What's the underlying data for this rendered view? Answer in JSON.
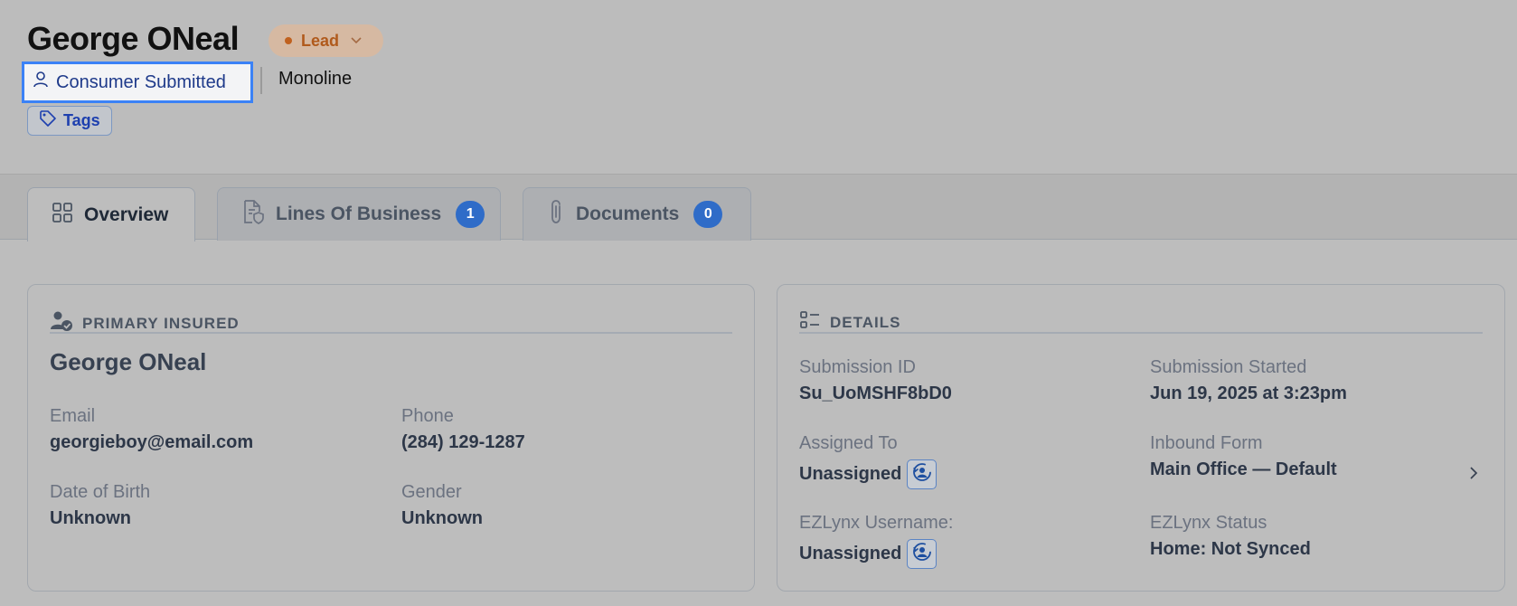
{
  "header": {
    "title": "George ONeal",
    "status": {
      "label": "Lead",
      "color": "#c0611f"
    },
    "source": "Consumer Submitted",
    "lob_type": "Monoline",
    "tags_label": "Tags"
  },
  "tabs": [
    {
      "label": "Overview",
      "icon": "grid-icon",
      "active": true
    },
    {
      "label": "Lines Of Business",
      "icon": "document-shield-icon",
      "badge": "1"
    },
    {
      "label": "Documents",
      "icon": "paperclip-icon",
      "badge": "0"
    }
  ],
  "primary_insured": {
    "heading": "PRIMARY INSURED",
    "name": "George ONeal",
    "fields": {
      "email": {
        "label": "Email",
        "value": "georgieboy@email.com"
      },
      "phone": {
        "label": "Phone",
        "value": "(284) 129-1287"
      },
      "dob": {
        "label": "Date of Birth",
        "value": "Unknown"
      },
      "gender": {
        "label": "Gender",
        "value": "Unknown"
      }
    }
  },
  "details": {
    "heading": "DETAILS",
    "submission_id": {
      "label": "Submission ID",
      "value": "Su_UoMSHF8bD0"
    },
    "submission_started": {
      "label": "Submission Started",
      "value": "Jun 19, 2025 at 3:23pm"
    },
    "assigned_to": {
      "label": "Assigned To",
      "value": "Unassigned"
    },
    "inbound_form": {
      "label": "Inbound Form",
      "value": "Main Office — Default"
    },
    "ezlynx_username": {
      "label": "EZLynx Username:",
      "value": "Unassigned"
    },
    "ezlynx_status": {
      "label": "EZLynx Status",
      "value": "Home: Not Synced"
    }
  },
  "colors": {
    "accent": "#2f6cc8",
    "focus_ring": "#3b82f6",
    "lead": "#c0611f"
  }
}
